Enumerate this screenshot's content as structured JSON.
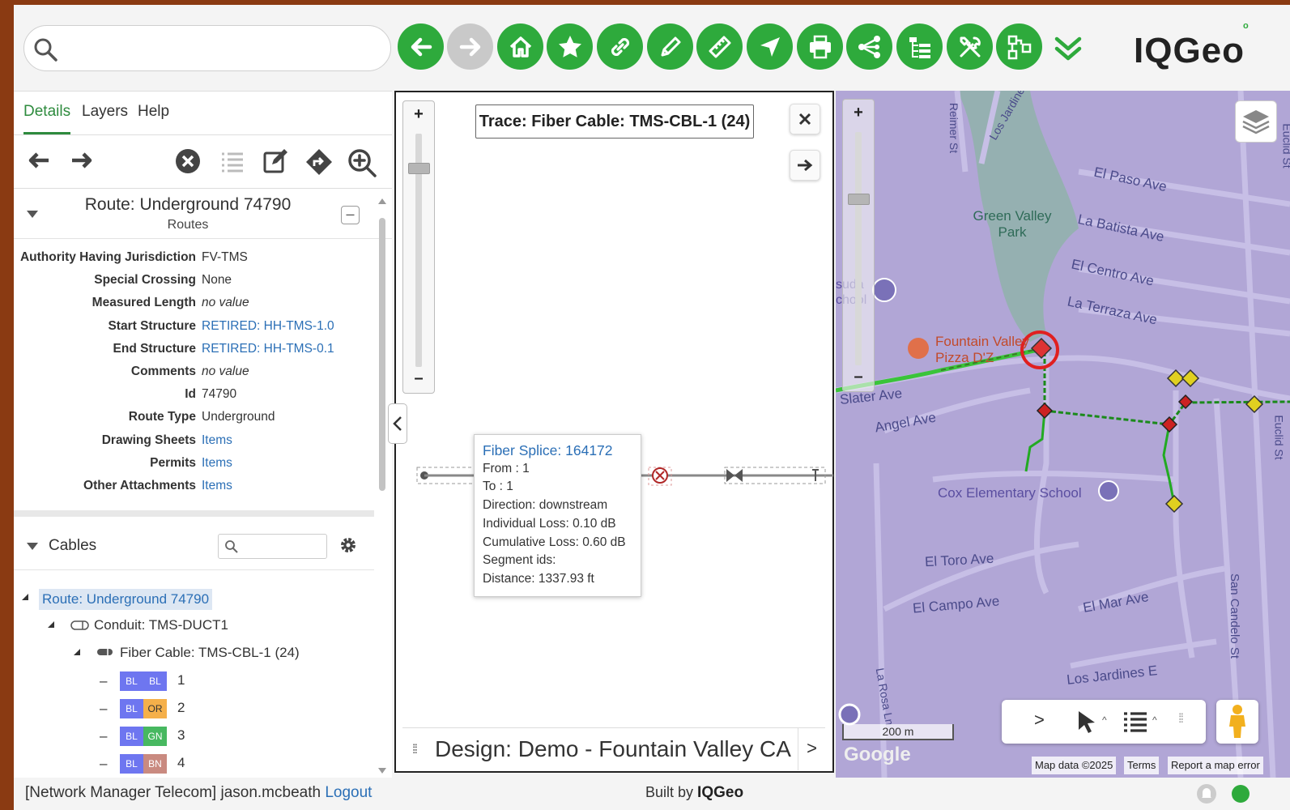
{
  "toolbar": {
    "search_placeholder": "",
    "buttons": [
      "back",
      "forward",
      "home",
      "bookmarks",
      "link",
      "edit",
      "measure",
      "navigate",
      "print",
      "share",
      "network-trace",
      "tools",
      "structure-view"
    ],
    "brand": "IQGeo",
    "accent_color": "#2eaa3c"
  },
  "left_panel": {
    "tabs": [
      "Details",
      "Layers",
      "Help"
    ],
    "active_tab": "Details",
    "feature": {
      "title": "Route: Underground 74790",
      "subtitle": "Routes",
      "properties": [
        {
          "label": "Authority Having Jurisdiction",
          "value": "FV-TMS",
          "type": "text"
        },
        {
          "label": "Special Crossing",
          "value": "None",
          "type": "text"
        },
        {
          "label": "Measured Length",
          "value": "no value",
          "type": "empty"
        },
        {
          "label": "Start Structure",
          "value": "RETIRED: HH-TMS-1.0",
          "type": "link"
        },
        {
          "label": "End Structure",
          "value": "RETIRED: HH-TMS-0.1",
          "type": "link"
        },
        {
          "label": "Comments",
          "value": "no value",
          "type": "empty"
        },
        {
          "label": "Id",
          "value": "74790",
          "type": "text"
        },
        {
          "label": "Route Type",
          "value": "Underground",
          "type": "text"
        },
        {
          "label": "Drawing Sheets",
          "value": "Items",
          "type": "link"
        },
        {
          "label": "Permits",
          "value": "Items",
          "type": "link"
        },
        {
          "label": "Other Attachments",
          "value": "Items",
          "type": "link"
        }
      ]
    },
    "cables": {
      "title": "Cables",
      "search_placeholder": "",
      "tree": {
        "route": "Route: Underground 74790",
        "conduit": "Conduit: TMS-DUCT1",
        "cable": "Fiber Cable: TMS-CBL-1 (24)",
        "fibers": [
          {
            "n": "1",
            "a": "BL",
            "b": "BL",
            "a_color": "#6e76f0",
            "b_color": "#6e76f0"
          },
          {
            "n": "2",
            "a": "BL",
            "b": "OR",
            "a_color": "#6e76f0",
            "b_color": "#f5b04a"
          },
          {
            "n": "3",
            "a": "BL",
            "b": "GN",
            "a_color": "#6e76f0",
            "b_color": "#47b860"
          },
          {
            "n": "4",
            "a": "BL",
            "b": "BN",
            "a_color": "#6e76f0",
            "b_color": "#c98a80"
          }
        ]
      }
    }
  },
  "trace_panel": {
    "title": "Trace: Fiber Cable: TMS-CBL-1 (24)",
    "popup": {
      "title": "Fiber Splice: 164172",
      "lines": [
        "From : 1",
        "To : 1",
        "Direction: downstream",
        "Individual Loss: 0.10 dB",
        "Cumulative Loss: 0.60 dB",
        "Segment ids:",
        "Distance: 1337.93 ft"
      ]
    },
    "design": "Design: Demo - Fountain Valley CA"
  },
  "map": {
    "streets": [
      "El Paso Ave",
      "La Batista Ave",
      "El Centro Ave",
      "La Terraza Ave",
      "Slater Ave",
      "Angel Ave",
      "El Toro Ave",
      "El Campo Ave",
      "El Mar Ave",
      "Los Jardines E",
      "Reimer St",
      "Los Jardine",
      "San Candelo St",
      "Euclid St",
      "La Rosa Ln",
      "Euclid St"
    ],
    "places": [
      "Green Valley Park",
      "Fountain Valley Pizza D'Z",
      "Cox Elementary School",
      "suda chool"
    ],
    "scale": "200 m",
    "attribution": [
      "Map data ©2025",
      "Terms",
      "Report a map error"
    ],
    "provider": "Google"
  },
  "status": {
    "user_prefix": "[Network Manager Telecom] jason.mcbeath",
    "logout": "Logout",
    "built_by": "Built by",
    "brand": "IQGeo"
  }
}
